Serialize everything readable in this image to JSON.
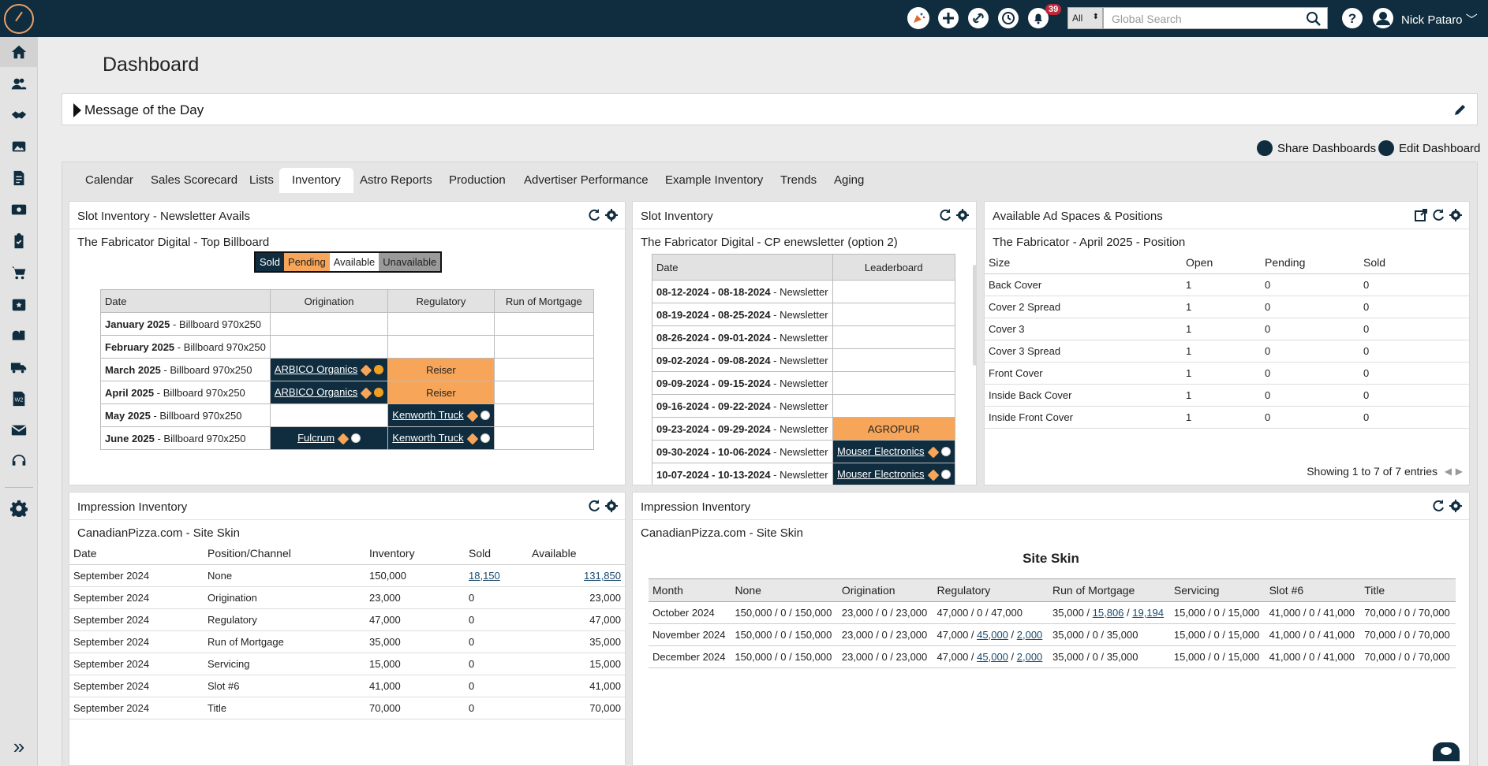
{
  "header": {
    "search_scope": "All",
    "search_placeholder": "Global Search",
    "notifications_count": "39",
    "user_name": "Nick Pataro"
  },
  "sidebar": {
    "items": [
      "home-icon",
      "contacts-icon",
      "handshake-icon",
      "media-icon",
      "document-icon",
      "finance-icon",
      "clipboard-icon",
      "cart-icon",
      "calendar-icon",
      "mailbox-icon",
      "truck-icon",
      "tax-form-icon",
      "mail-icon",
      "support-icon",
      "settings-icon",
      "expand-icon"
    ]
  },
  "page": {
    "title": "Dashboard",
    "motd_label": "Message of the Day",
    "share_label": "Share Dashboards",
    "edit_label": "Edit Dashboard"
  },
  "tabs": [
    "Calendar",
    "Sales Scorecard",
    "Lists",
    "Inventory",
    "Astro Reports",
    "Production",
    "Advertiser Performance",
    "Example Inventory",
    "Trends",
    "Aging"
  ],
  "active_tab": "Inventory",
  "slot_newsletter": {
    "title": "Slot Inventory - Newsletter Avails",
    "subtitle": "The Fabricator Digital - Top Billboard",
    "legend": [
      "Sold",
      "Pending",
      "Available",
      "Unavailable"
    ],
    "columns": [
      "Date",
      "Origination",
      "Regulatory",
      "Run of Mortgage"
    ],
    "rows": [
      {
        "date": "January 2025",
        "product": " - Billboard 970x250",
        "cells": [
          {
            "t": "",
            "s": ""
          },
          {
            "t": "",
            "s": ""
          },
          {
            "t": "",
            "s": ""
          }
        ]
      },
      {
        "date": "February 2025",
        "product": " - Billboard 970x250",
        "cells": [
          {
            "t": "",
            "s": ""
          },
          {
            "t": "",
            "s": ""
          },
          {
            "t": "",
            "s": ""
          }
        ]
      },
      {
        "date": "March 2025",
        "product": " - Billboard 970x250",
        "cells": [
          {
            "t": "ARBICO Organics",
            "s": "sold",
            "dot": "o"
          },
          {
            "t": "Reiser",
            "s": "pend"
          },
          {
            "t": "",
            "s": ""
          }
        ]
      },
      {
        "date": "April 2025",
        "product": " - Billboard 970x250",
        "cells": [
          {
            "t": "ARBICO Organics",
            "s": "sold",
            "dot": "o"
          },
          {
            "t": "Reiser",
            "s": "pend"
          },
          {
            "t": "",
            "s": ""
          }
        ]
      },
      {
        "date": "May 2025",
        "product": " - Billboard 970x250",
        "cells": [
          {
            "t": "",
            "s": ""
          },
          {
            "t": "Kenworth Truck",
            "s": "sold",
            "dot": "w"
          },
          {
            "t": "",
            "s": ""
          }
        ]
      },
      {
        "date": "June 2025",
        "product": " - Billboard 970x250",
        "cells": [
          {
            "t": "Fulcrum",
            "s": "sold",
            "dot": "w"
          },
          {
            "t": "Kenworth Truck",
            "s": "sold",
            "dot": "w"
          },
          {
            "t": "",
            "s": ""
          }
        ]
      }
    ]
  },
  "slot_inventory": {
    "title": "Slot Inventory",
    "subtitle": "The Fabricator Digital - CP enewsletter (option 2)",
    "columns": [
      "Date",
      "Leaderboard"
    ],
    "rows": [
      {
        "date": "08-12-2024 - 08-18-2024",
        "product": " - Newsletter",
        "cell": "",
        "s": ""
      },
      {
        "date": "08-19-2024 - 08-25-2024",
        "product": " - Newsletter",
        "cell": "",
        "s": ""
      },
      {
        "date": "08-26-2024 - 09-01-2024",
        "product": " - Newsletter",
        "cell": "",
        "s": ""
      },
      {
        "date": "09-02-2024 - 09-08-2024",
        "product": " - Newsletter",
        "cell": "",
        "s": ""
      },
      {
        "date": "09-09-2024 - 09-15-2024",
        "product": " - Newsletter",
        "cell": "",
        "s": ""
      },
      {
        "date": "09-16-2024 - 09-22-2024",
        "product": " - Newsletter",
        "cell": "",
        "s": ""
      },
      {
        "date": "09-23-2024 - 09-29-2024",
        "product": " - Newsletter",
        "cell": "AGROPUR",
        "s": "pend"
      },
      {
        "date": "09-30-2024 - 10-06-2024",
        "product": " - Newsletter",
        "cell": "Mouser Electronics",
        "s": "sold"
      },
      {
        "date": "10-07-2024 - 10-13-2024",
        "product": " - Newsletter",
        "cell": "Mouser Electronics",
        "s": "sold"
      }
    ]
  },
  "ad_spaces": {
    "title": "Available Ad Spaces & Positions",
    "subtitle": "The Fabricator - April 2025 - Position",
    "columns": [
      "Size",
      "Open",
      "Pending",
      "Sold"
    ],
    "rows": [
      [
        "Back Cover",
        "1",
        "0",
        "0"
      ],
      [
        "Cover 2 Spread",
        "1",
        "0",
        "0"
      ],
      [
        "Cover 3",
        "1",
        "0",
        "0"
      ],
      [
        "Cover 3 Spread",
        "1",
        "0",
        "0"
      ],
      [
        "Front Cover",
        "1",
        "0",
        "0"
      ],
      [
        "Inside Back Cover",
        "1",
        "0",
        "0"
      ],
      [
        "Inside Front Cover",
        "1",
        "0",
        "0"
      ]
    ],
    "footer": "Showing 1 to 7 of 7 entries"
  },
  "impression_left": {
    "title": "Impression Inventory",
    "subtitle": "CanadianPizza.com - Site Skin",
    "columns": [
      "Date",
      "Position/Channel",
      "Inventory",
      "Sold",
      "Available"
    ],
    "rows": [
      [
        "September 2024",
        "None",
        "150,000",
        "18,150",
        "131,850"
      ],
      [
        "September 2024",
        "Origination",
        "23,000",
        "0",
        "23,000"
      ],
      [
        "September 2024",
        "Regulatory",
        "47,000",
        "0",
        "47,000"
      ],
      [
        "September 2024",
        "Run of Mortgage",
        "35,000",
        "0",
        "35,000"
      ],
      [
        "September 2024",
        "Servicing",
        "15,000",
        "0",
        "15,000"
      ],
      [
        "September 2024",
        "Slot #6",
        "41,000",
        "0",
        "41,000"
      ],
      [
        "September 2024",
        "Title",
        "70,000",
        "0",
        "70,000"
      ]
    ]
  },
  "impression_right": {
    "title": "Impression Inventory",
    "subtitle": "CanadianPizza.com - Site Skin",
    "table_title": "Site Skin",
    "columns": [
      "Month",
      "None",
      "Origination",
      "Regulatory",
      "Run of Mortgage",
      "Servicing",
      "Slot #6",
      "Title"
    ],
    "rows": [
      {
        "month": "October 2024",
        "none": "150,000 / 0 / 150,000",
        "orig": "23,000 / 0 / 23,000",
        "reg": [
          "47,000 / 0 / 47,000"
        ],
        "rom": [
          "35,000 / ",
          "15,806",
          " / ",
          "19,194"
        ],
        "serv": "15,000 / 0 / 15,000",
        "slot": "41,000 / 0 / 41,000",
        "title": "70,000 / 0 / 70,000"
      },
      {
        "month": "November 2024",
        "none": "150,000 / 0 / 150,000",
        "orig": "23,000 / 0 / 23,000",
        "reg": [
          "47,000 / ",
          "45,000",
          " / ",
          "2,000"
        ],
        "rom": [
          "35,000 / 0 / 35,000"
        ],
        "serv": "15,000 / 0 / 15,000",
        "slot": "41,000 / 0 / 41,000",
        "title": "70,000 / 0 / 70,000"
      },
      {
        "month": "December 2024",
        "none": "150,000 / 0 / 150,000",
        "orig": "23,000 / 0 / 23,000",
        "reg": [
          "47,000 / ",
          "45,000",
          " / ",
          "2,000"
        ],
        "rom": [
          "35,000 / 0 / 35,000"
        ],
        "serv": "15,000 / 0 / 15,000",
        "slot": "41,000 / 0 / 41,000",
        "title": "70,000 / 0 / 70,000"
      }
    ]
  },
  "colors": {
    "navy": "#0f2d3f",
    "pending": "#f7a559",
    "unavailable": "#9a9a9a",
    "badge": "#c0273b"
  }
}
